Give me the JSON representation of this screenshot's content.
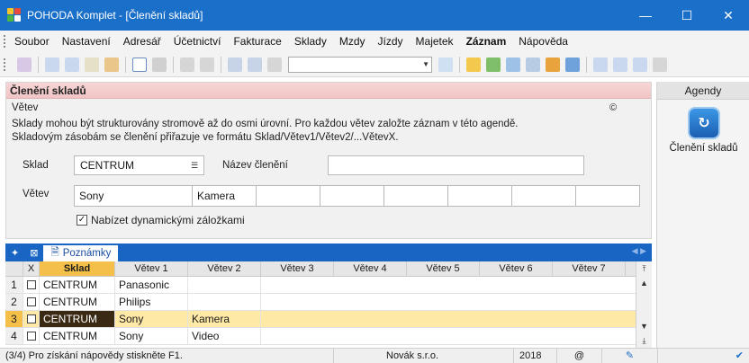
{
  "window": {
    "title": "POHODA Komplet - [Členění skladů]",
    "minimize": "—",
    "maximize": "☐",
    "close": "✕"
  },
  "menu": [
    "Soubor",
    "Nastavení",
    "Adresář",
    "Účetnictví",
    "Fakturace",
    "Sklady",
    "Mzdy",
    "Jízdy",
    "Majetek",
    "Záznam",
    "Nápověda"
  ],
  "form": {
    "header": "Členění skladů",
    "section": "Větev",
    "info_line1": "Sklady mohou být strukturovány stromově až do osmi úrovní. Pro každou větev založte záznam v této agendě.",
    "info_line2": "Skladovým zásobám se členění přiřazuje ve formátu Sklad/Větev1/Větev2/...VětevX.",
    "sklad_label": "Sklad",
    "sklad_value": "CENTRUM",
    "nazev_label": "Název členění",
    "nazev_value": "",
    "vetev_label": "Větev",
    "branches": [
      "Sony",
      "Kamera",
      "",
      "",
      "",
      "",
      "",
      ""
    ],
    "checkbox_label": "Nabízet dynamickými záložkami",
    "checkbox_checked": true,
    "copyright_mark": "©"
  },
  "agenda": {
    "header": "Agendy",
    "item_label": "Členění skladů"
  },
  "tabs": {
    "pin": "✦",
    "filter": "⊠",
    "notes": "Poznámky"
  },
  "grid": {
    "columns": [
      "",
      "X",
      "Sklad",
      "Větev 1",
      "Větev 2",
      "Větev 3",
      "Větev 4",
      "Větev 5",
      "Větev 6",
      "Větev 7"
    ],
    "rows": [
      {
        "num": "1",
        "sklad": "CENTRUM",
        "v1": "Panasonic",
        "v2": ""
      },
      {
        "num": "2",
        "sklad": "CENTRUM",
        "v1": "Philips",
        "v2": ""
      },
      {
        "num": "3",
        "sklad": "CENTRUM",
        "v1": "Sony",
        "v2": "Kamera"
      },
      {
        "num": "4",
        "sklad": "CENTRUM",
        "v1": "Sony",
        "v2": "Video"
      }
    ],
    "selected_row": 3
  },
  "status": {
    "hint": "(3/4) Pro získání nápovědy stiskněte F1.",
    "company": "Novák s.r.o.",
    "year": "2018",
    "at": "@"
  }
}
